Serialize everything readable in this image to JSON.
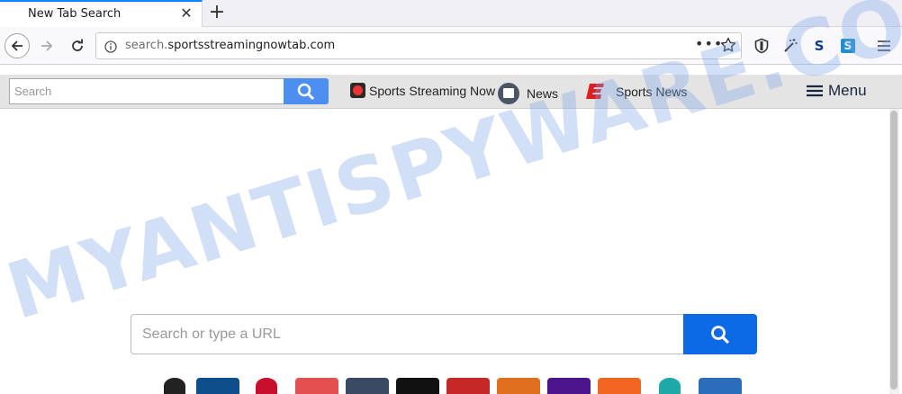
{
  "browser": {
    "tab_title": "New Tab Search",
    "url_prefix": "search.",
    "url_host": "sportsstreamingnowtab.com"
  },
  "pagebar": {
    "search_placeholder": "Search",
    "links": [
      {
        "label": "Sports Streaming Now"
      },
      {
        "label": "News"
      },
      {
        "label": "Sports News"
      }
    ],
    "menu_label": "Menu"
  },
  "main": {
    "search_placeholder": "Search or type a URL"
  },
  "tiles": [
    {
      "name": "tile-1",
      "color": "#222222"
    },
    {
      "name": "tile-2",
      "color": "#0d4f8b"
    },
    {
      "name": "tile-3",
      "color": "#c8102e"
    },
    {
      "name": "tile-4",
      "color": "#e45050"
    },
    {
      "name": "tile-5",
      "color": "#3a4a64"
    },
    {
      "name": "tile-6",
      "color": "#111111"
    },
    {
      "name": "tile-7",
      "color": "#c62828"
    },
    {
      "name": "tile-8",
      "color": "#e07020"
    },
    {
      "name": "tile-9",
      "color": "#4a148c"
    },
    {
      "name": "tile-10",
      "color": "#f26522"
    },
    {
      "name": "tile-11",
      "color": "#1fa8a8"
    },
    {
      "name": "tile-12",
      "color": "#2a6ebb"
    }
  ],
  "watermark": "MYANTISPYWARE.COM"
}
